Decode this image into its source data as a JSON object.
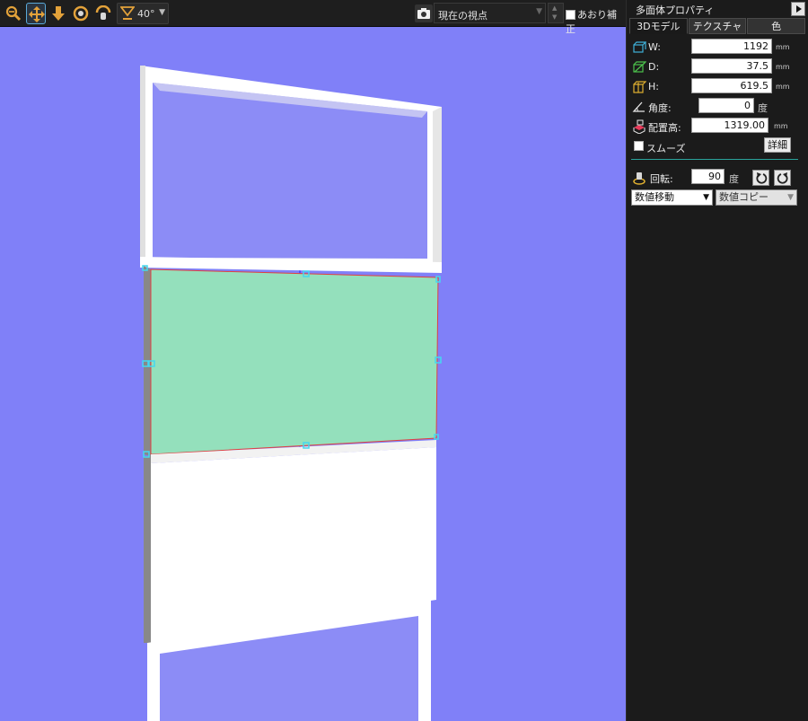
{
  "toolbar": {
    "fov": "40°",
    "view_select": "現在の視点",
    "tilt_label": "あおり補正"
  },
  "panel": {
    "title": "多面体プロパティ",
    "tabs": [
      "3Dモデル",
      "テクスチャ",
      "色"
    ],
    "w": {
      "label": "W:",
      "value": "1192",
      "unit": "mm"
    },
    "d": {
      "label": "D:",
      "value": "37.5",
      "unit": "mm"
    },
    "h": {
      "label": "H:",
      "value": "619.5",
      "unit": "mm"
    },
    "angle": {
      "label": "角度:",
      "value": "0",
      "unit": "度"
    },
    "elevation": {
      "label": "配置高:",
      "value": "1319.00",
      "unit": "mm"
    },
    "smooth_label": "スムーズ",
    "detail_button": "詳細",
    "rotation": {
      "label": "回転:",
      "value": "90",
      "unit": "度"
    },
    "move_dropdown": "数値移動",
    "copy_dropdown": "数値コピー"
  },
  "colors": {
    "viewport_bg": "#8080f8",
    "selection": "#94e0bc",
    "handle": "#44d8f0"
  }
}
